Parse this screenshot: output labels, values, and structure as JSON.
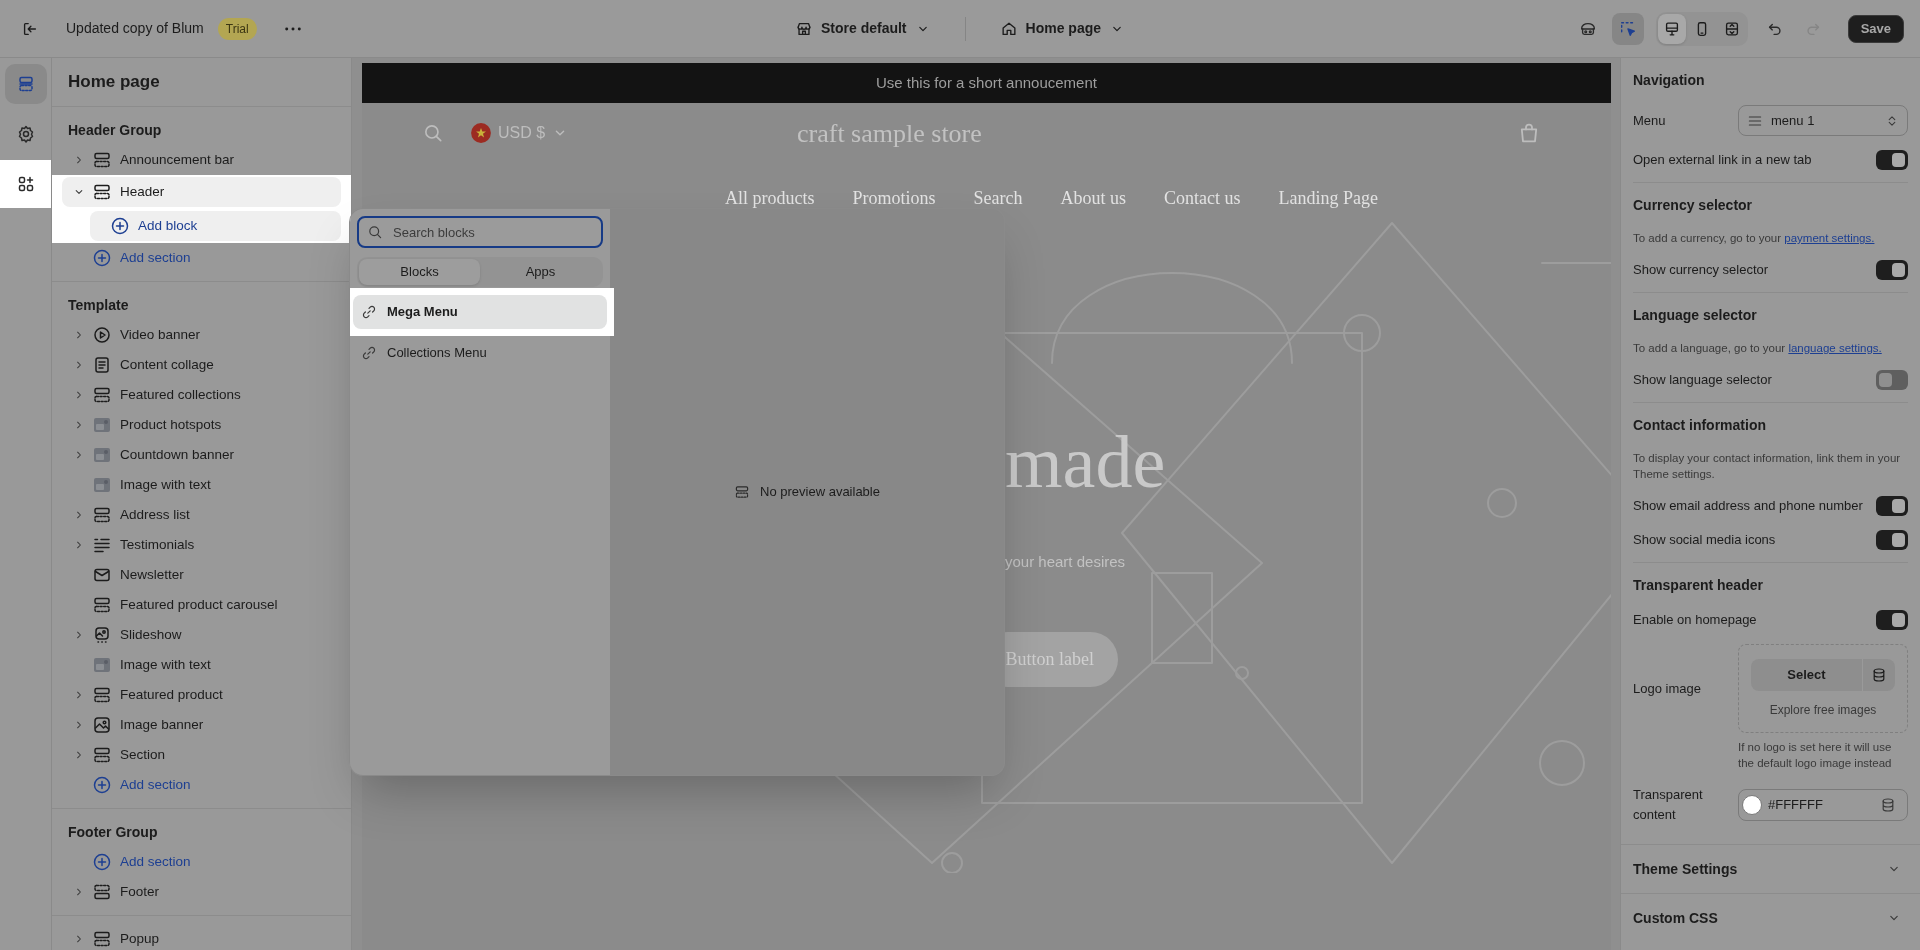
{
  "topbar": {
    "title": "Updated copy of Blum",
    "badge": "Trial",
    "store": "Store default",
    "page": "Home page",
    "save": "Save",
    "tools": [
      {
        "kind": "theme",
        "selected": false
      },
      {
        "kind": "inspector",
        "selected": true
      }
    ],
    "views": [
      {
        "kind": "desktop",
        "selected": true
      },
      {
        "kind": "mobile",
        "selected": false
      },
      {
        "kind": "fullwidth",
        "selected": false
      }
    ],
    "history": [
      {
        "kind": "undo",
        "disabled": false
      },
      {
        "kind": "redo",
        "disabled": true
      }
    ]
  },
  "rail": [
    {
      "kind": "sections",
      "selected": true,
      "highlighted": false
    },
    {
      "kind": "settings",
      "selected": false,
      "highlighted": false
    },
    {
      "kind": "apps",
      "selected": false,
      "highlighted": true
    }
  ],
  "sidebar": {
    "title": "Home page",
    "groups": [
      {
        "title": "Header Group",
        "items": [
          {
            "kind": "layout",
            "label": "Announcement bar",
            "expandable": true,
            "expanded": false,
            "highlighted": false
          },
          {
            "kind": "layout",
            "label": "Header",
            "expandable": true,
            "expanded": true,
            "highlighted": true,
            "children": [
              {
                "kind": "add",
                "label": "Add block",
                "highlighted": true
              }
            ]
          },
          {
            "kind": "add",
            "label": "Add section",
            "expandable": false,
            "highlighted": false
          }
        ]
      },
      {
        "title": "Template",
        "items": [
          {
            "kind": "video",
            "label": "Video banner",
            "expandable": true,
            "expanded": false,
            "highlighted": false
          },
          {
            "kind": "text",
            "label": "Content collage",
            "expandable": true,
            "expanded": false,
            "highlighted": false
          },
          {
            "kind": "layout",
            "label": "Featured collections",
            "expandable": true,
            "expanded": false,
            "highlighted": false
          },
          {
            "kind": "photo",
            "label": "Product hotspots",
            "expandable": true,
            "expanded": false,
            "highlighted": false
          },
          {
            "kind": "photo",
            "label": "Countdown banner",
            "expandable": true,
            "expanded": false,
            "highlighted": false
          },
          {
            "kind": "photo",
            "label": "Image with text",
            "expandable": false,
            "highlighted": false
          },
          {
            "kind": "layout",
            "label": "Address list",
            "expandable": true,
            "expanded": false,
            "highlighted": false
          },
          {
            "kind": "list",
            "label": "Testimonials",
            "expandable": true,
            "expanded": false,
            "highlighted": false
          },
          {
            "kind": "mail",
            "label": "Newsletter",
            "expandable": false,
            "highlighted": false
          },
          {
            "kind": "layout",
            "label": "Featured product carousel",
            "expandable": false,
            "highlighted": false
          },
          {
            "kind": "slideshow",
            "label": "Slideshow",
            "expandable": true,
            "expanded": false,
            "highlighted": false
          },
          {
            "kind": "photo",
            "label": "Image with text",
            "expandable": false,
            "highlighted": false
          },
          {
            "kind": "layout",
            "label": "Featured product",
            "expandable": true,
            "expanded": false,
            "highlighted": false
          },
          {
            "kind": "banner",
            "label": "Image banner",
            "expandable": true,
            "expanded": false,
            "highlighted": false
          },
          {
            "kind": "layout",
            "label": "Section",
            "expandable": true,
            "expanded": false,
            "highlighted": false
          },
          {
            "kind": "add",
            "label": "Add section",
            "expandable": false,
            "highlighted": false
          }
        ]
      },
      {
        "title": "Footer Group",
        "items": [
          {
            "kind": "add",
            "label": "Add section",
            "expandable": false,
            "highlighted": false
          },
          {
            "kind": "footer",
            "label": "Footer",
            "expandable": true,
            "expanded": false,
            "highlighted": false
          }
        ]
      },
      {
        "items": [
          {
            "kind": "layout",
            "label": "Popup",
            "expandable": true,
            "expanded": false,
            "highlighted": false
          }
        ]
      }
    ]
  },
  "preview": {
    "announcement": "Use this for a short annoucement",
    "currency": "USD $",
    "store_name": "craft sample store",
    "nav": [
      "All products",
      "Promotions",
      "Search",
      "About us",
      "Contact us",
      "Landing Page"
    ],
    "hero_title": "made",
    "hero_text": "your heart desires",
    "hero_button": "Button label"
  },
  "block_picker": {
    "search_placeholder": "Search blocks",
    "tabs": [
      {
        "label": "Blocks",
        "selected": true
      },
      {
        "label": "Apps",
        "selected": false
      }
    ],
    "blocks": [
      {
        "label": "Mega Menu",
        "selected": true,
        "highlighted": true
      },
      {
        "label": "Collections Menu",
        "selected": false,
        "highlighted": false
      }
    ],
    "preview_text": "No preview available"
  },
  "settings": {
    "sections": [
      {
        "title": "Navigation",
        "rows": [
          {
            "kind": "select",
            "label": "Menu",
            "value": "menu 1"
          },
          {
            "kind": "toggle",
            "label": "Open external link in a new tab",
            "on": true
          }
        ]
      },
      {
        "title": "Currency selector",
        "rows": [
          {
            "kind": "note",
            "text": "To add a currency, go to your ",
            "link": "payment settings."
          },
          {
            "kind": "toggle",
            "label": "Show currency selector",
            "on": true
          }
        ]
      },
      {
        "title": "Language selector",
        "rows": [
          {
            "kind": "note",
            "text": "To add a language, go to your ",
            "link": "language settings."
          },
          {
            "kind": "toggle",
            "label": "Show language selector",
            "on": false
          }
        ]
      },
      {
        "title": "Contact information",
        "rows": [
          {
            "kind": "note",
            "text": "To display your contact information, link them in your Theme settings."
          },
          {
            "kind": "toggle",
            "label": "Show email address and phone number",
            "on": true
          },
          {
            "kind": "toggle",
            "label": "Show social media icons",
            "on": true
          }
        ]
      },
      {
        "title": "Transparent header",
        "rows": [
          {
            "kind": "toggle",
            "label": "Enable on homepage",
            "on": true
          },
          {
            "kind": "image",
            "label": "Logo image",
            "button": "Select",
            "explore": "Explore free images",
            "help": "If no logo is set here it will use the default logo image instead"
          },
          {
            "kind": "color",
            "label": "Transparent content",
            "value": "#FFFFFF"
          }
        ]
      }
    ],
    "collapsed": [
      {
        "title": "Theme Settings"
      },
      {
        "title": "Custom CSS"
      }
    ]
  }
}
